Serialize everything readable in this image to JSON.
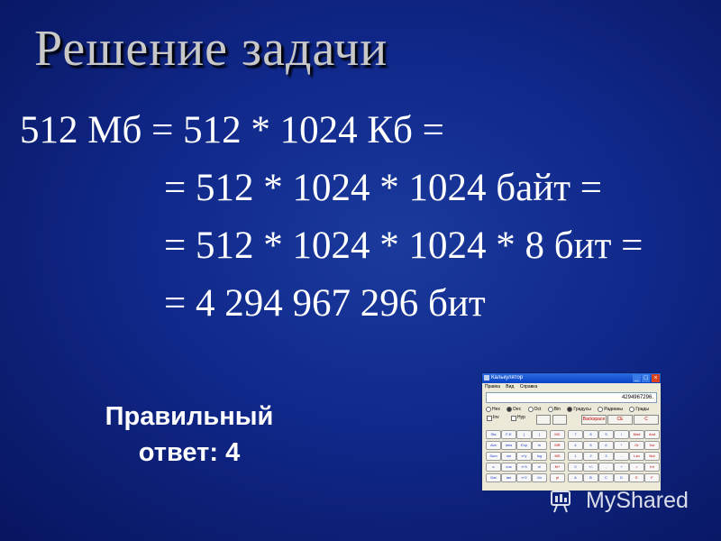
{
  "slide": {
    "title": "Решение задачи",
    "lines": [
      "512 Мб = 512 * 1024 Кб =",
      "= 512 * 1024 * 1024 байт =",
      "= 512 * 1024 * 1024 * 8 бит =",
      "= 4 294 967 296 бит"
    ],
    "answer_line1": "Правильный",
    "answer_line2": "ответ: 4"
  },
  "calculator": {
    "window_title": "Калькулятор",
    "menu": [
      "Правка",
      "Вид",
      "Справка"
    ],
    "display": "4294967296.",
    "radios": [
      "Hex",
      "Dec",
      "Oct",
      "Bin",
      "Градусы",
      "Радианы",
      "Грады"
    ],
    "checkboxes": [
      "Inv",
      "Hyp"
    ],
    "buttons_top": [
      "Backspace",
      "CE",
      "C"
    ],
    "keys": [
      [
        "Sta",
        "F-E",
        "(",
        ")",
        "MC",
        "7",
        "8",
        "9",
        "/",
        "Mod",
        "And"
      ],
      [
        "Ave",
        "dms",
        "Exp",
        "ln",
        "MR",
        "4",
        "5",
        "6",
        "*",
        "Or",
        "Xor"
      ],
      [
        "Sum",
        "sin",
        "x^y",
        "log",
        "MS",
        "1",
        "2",
        "3",
        "-",
        "Lsh",
        "Not"
      ],
      [
        "s",
        "cos",
        "x^3",
        "n!",
        "M+",
        "0",
        "+/-",
        ",",
        "+",
        "=",
        "Int"
      ],
      [
        "Dat",
        "tan",
        "x^2",
        "1/x",
        "pi",
        "A",
        "B",
        "C",
        "D",
        "E",
        "F"
      ]
    ]
  },
  "watermark": {
    "text": "MyShared"
  },
  "colors": {
    "background": "#10288a",
    "title": "#c8c8c8",
    "text": "#ffffff"
  }
}
